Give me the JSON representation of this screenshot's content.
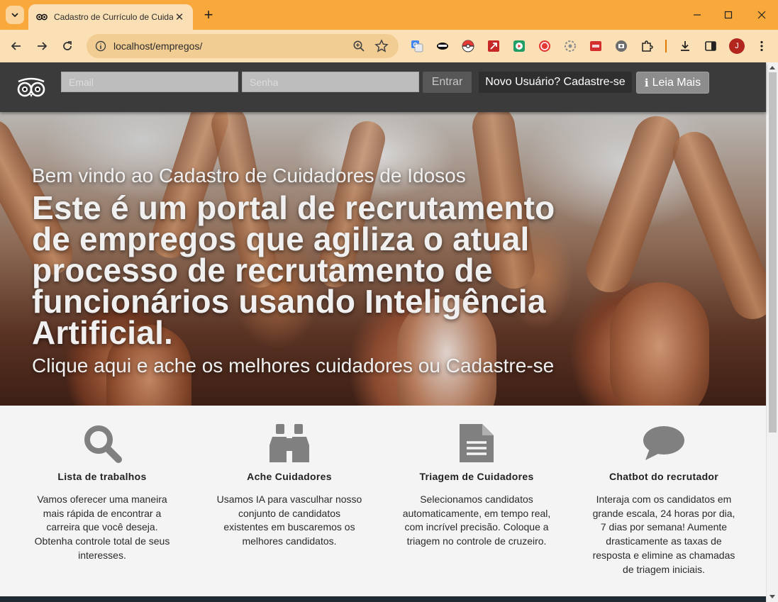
{
  "browser": {
    "tab_title": "Cadastro de Currículo de Cuidadores",
    "url": "localhost/empregos/",
    "profile_initial": "J",
    "extensions": [
      "google-translate-icon",
      "mask-icon",
      "pokeball-icon",
      "arrow-ext-icon",
      "play-ext-icon",
      "record-ext-icon",
      "settings-ext-icon",
      "red-square-ext-icon",
      "camera-ext-icon"
    ]
  },
  "site": {
    "login": {
      "email_placeholder": "Email",
      "password_placeholder": "Senha",
      "submit_label": "Entrar"
    },
    "signup_label": "Novo Usuário? Cadastre-se",
    "read_more_label": "Leia Mais"
  },
  "hero": {
    "welcome": "Bem vindo ao Cadastro de Cuidadores de Idosos",
    "headline": "Este é um portal de recrutamento de empregos que agiliza o atual processo de recrutamento de funcionários usando Inteligência Artificial.",
    "cta_find": "Clique aqui e ache os melhores cuidadores",
    "cta_or": "ou",
    "cta_register": "Cadastre-se"
  },
  "features": [
    {
      "icon": "search-icon",
      "title": "Lista de trabalhos",
      "description": "Vamos oferecer uma maneira mais rápida de encontrar a carreira que você deseja. Obtenha controle total de seus interesses."
    },
    {
      "icon": "binoculars-icon",
      "title": "Ache Cuidadores",
      "description": "Usamos IA para vasculhar nosso conjunto de candidatos existentes em buscaremos os melhores candidatos."
    },
    {
      "icon": "document-icon",
      "title": "Triagem de Cuidadores",
      "description": "Selecionamos candidatos automaticamente, em tempo real, com incrível precisão. Coloque a triagem no controle de cruzeiro."
    },
    {
      "icon": "chat-bubble-icon",
      "title": "Chatbot do recrutador",
      "description": "Interaja com os candidatos em grande escala, 24 horas por dia, 7 dias por semana! Aumente drasticamente as taxas de resposta e elimine as chamadas de triagem iniciais."
    }
  ],
  "colors": {
    "browser_frame": "#f9a83b",
    "nav_background": "#3b3b3b",
    "feature_icon": "#808080",
    "features_background": "#f4f4f4"
  }
}
